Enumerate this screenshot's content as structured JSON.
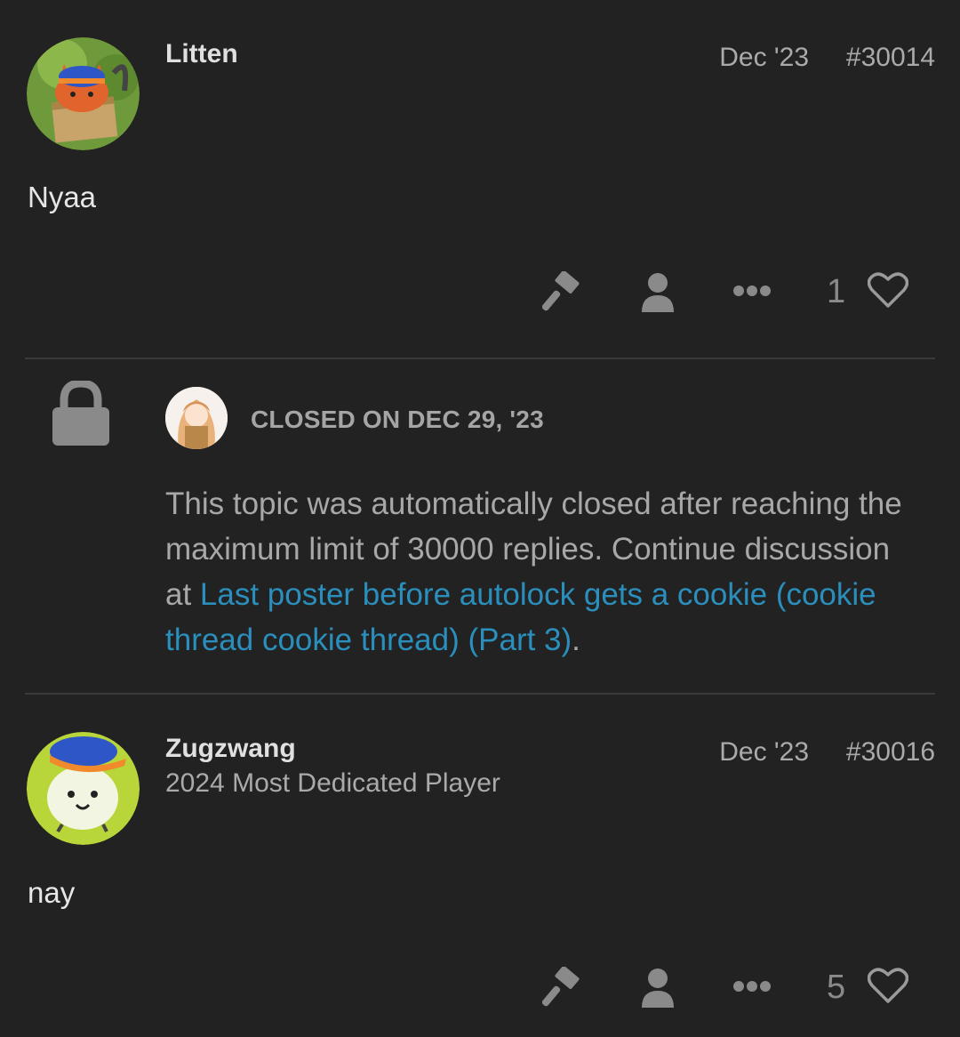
{
  "posts": [
    {
      "username": "Litten",
      "date": "Dec '23",
      "number": "#30014",
      "body": "Nyaa",
      "likes": "1",
      "avatar_icon": "litten-avatar"
    },
    {
      "username": "Zugzwang",
      "user_title": "2024 Most Dedicated Player",
      "date": "Dec '23",
      "number": "#30016",
      "body": "nay",
      "likes": "5",
      "avatar_icon": "cat-avatar"
    }
  ],
  "closed_notice": {
    "title": "CLOSED ON DEC 29, '23",
    "text_before": "This topic was automatically closed after reaching the maximum limit of 30000 replies. Continue discussion at ",
    "link_text": "Last poster before autolock gets a cookie (cookie thread cookie thread) (Part 3)",
    "text_after": "."
  },
  "actions": {
    "icons": [
      "hammer-icon",
      "user-icon",
      "more-icon",
      "heart-icon"
    ]
  },
  "colors": {
    "background": "#222222",
    "link": "#2a8fbd",
    "muted": "#aaaaaa"
  }
}
